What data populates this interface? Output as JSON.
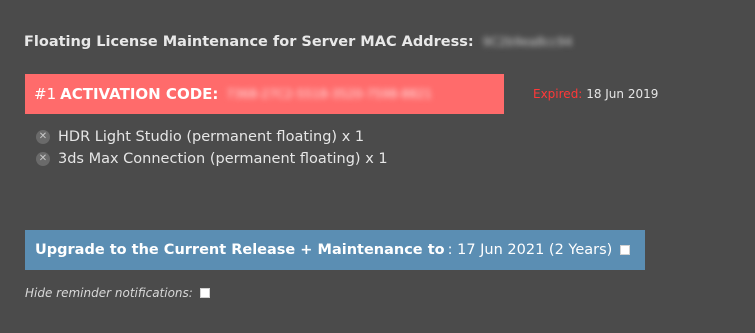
{
  "header": {
    "title": "Floating License Maintenance for Server MAC Address:",
    "mac": "9C2b9ea8cc94"
  },
  "activation": {
    "number": "#1",
    "label": "ACTIVATION CODE:",
    "code": "7368-27C2-5518-3520-7598-8821",
    "expired_label": "Expired:",
    "expired_date": "18 Jun 2019"
  },
  "products": [
    {
      "name": "HDR Light Studio (permanent floating) x 1",
      "icon": "remove-icon"
    },
    {
      "name": "3ds Max Connection (permanent floating) x 1",
      "icon": "remove-icon"
    }
  ],
  "upgrade": {
    "label": "Upgrade to the Current Release + Maintenance to",
    "date": ": 17 Jun 2021 (2 Years)",
    "checked": false
  },
  "reminder": {
    "label": "Hide reminder notifications:",
    "checked": false
  },
  "colors": {
    "background": "#4b4b4b",
    "activation_bar": "#ff6b6b",
    "expired": "#ff3838",
    "upgrade_bar": "#5b8eb3"
  }
}
